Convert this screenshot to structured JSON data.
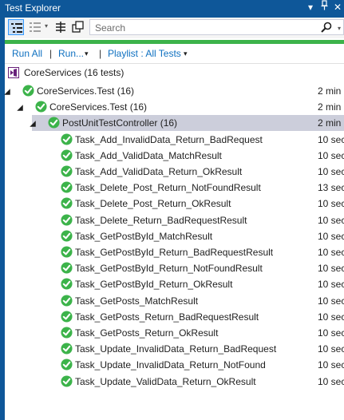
{
  "window": {
    "title": "Test Explorer",
    "dropdown_glyph": "▾",
    "pin_glyph": "ᵖ",
    "close_glyph": "✕"
  },
  "toolbar": {
    "search_placeholder": "Search"
  },
  "actions": {
    "run_all": "Run All",
    "run": "Run...",
    "playlist": "Playlist : All Tests",
    "separator": "|"
  },
  "solution": {
    "label": "CoreServices (16 tests)"
  },
  "tree": [
    {
      "name": "CoreServices.Test (16)",
      "duration": "2 min",
      "level": 0
    },
    {
      "name": "CoreServices.Test (16)",
      "duration": "2 min",
      "level": 1
    },
    {
      "name": "PostUnitTestController (16)",
      "duration": "2 min",
      "level": 2,
      "selected": true
    },
    {
      "name": "Task_Add_InvalidData_Return_BadRequest",
      "duration": "10 sec",
      "level": 3
    },
    {
      "name": "Task_Add_ValidData_MatchResult",
      "duration": "10 sec",
      "level": 3
    },
    {
      "name": "Task_Add_ValidData_Return_OkResult",
      "duration": "10 sec",
      "level": 3
    },
    {
      "name": "Task_Delete_Post_Return_NotFoundResult",
      "duration": "13 sec",
      "level": 3
    },
    {
      "name": "Task_Delete_Post_Return_OkResult",
      "duration": "10 sec",
      "level": 3
    },
    {
      "name": "Task_Delete_Return_BadRequestResult",
      "duration": "10 sec",
      "level": 3
    },
    {
      "name": "Task_GetPostById_MatchResult",
      "duration": "10 sec",
      "level": 3
    },
    {
      "name": "Task_GetPostById_Return_BadRequestResult",
      "duration": "10 sec",
      "level": 3
    },
    {
      "name": "Task_GetPostById_Return_NotFoundResult",
      "duration": "10 sec",
      "level": 3
    },
    {
      "name": "Task_GetPostById_Return_OkResult",
      "duration": "10 sec",
      "level": 3
    },
    {
      "name": "Task_GetPosts_MatchResult",
      "duration": "10 sec",
      "level": 3
    },
    {
      "name": "Task_GetPosts_Return_BadRequestResult",
      "duration": "10 sec",
      "level": 3
    },
    {
      "name": "Task_GetPosts_Return_OkResult",
      "duration": "10 sec",
      "level": 3
    },
    {
      "name": "Task_Update_InvalidData_Return_BadRequest",
      "duration": "10 sec",
      "level": 3
    },
    {
      "name": "Task_Update_InvalidData_Return_NotFound",
      "duration": "10 sec",
      "level": 3
    },
    {
      "name": "Task_Update_ValidData_Return_OkResult",
      "duration": "10 sec",
      "level": 3
    }
  ],
  "colors": {
    "title_bar": "#0e5799",
    "pass_green": "#3cb34a",
    "link_blue": "#0e70c0",
    "selected_row": "#cccedb"
  },
  "icons": {
    "passed": "check-circle-icon",
    "solution": "visual-studio-solution-icon"
  }
}
